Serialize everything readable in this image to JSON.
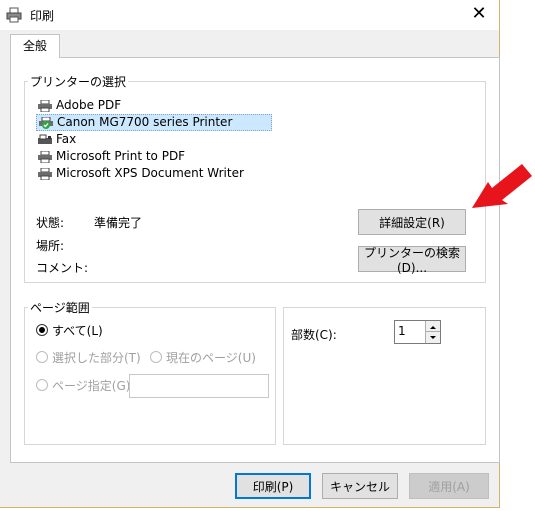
{
  "window": {
    "title": "印刷",
    "close_glyph": "✕"
  },
  "tabs": [
    {
      "label": "全般"
    }
  ],
  "printer_group": {
    "label": "プリンターの選択",
    "printers": [
      {
        "name": "Adobe PDF",
        "icon": "printer-icon",
        "selected": false
      },
      {
        "name": "Canon MG7700 series Printer",
        "icon": "printer-default-icon",
        "selected": true
      },
      {
        "name": "Fax",
        "icon": "fax-icon",
        "selected": false
      },
      {
        "name": "Microsoft Print to PDF",
        "icon": "printer-icon",
        "selected": false
      },
      {
        "name": "Microsoft XPS Document Writer",
        "icon": "printer-icon",
        "selected": false
      }
    ],
    "status_label": "状態:",
    "status_value": "準備完了",
    "location_label": "場所:",
    "comment_label": "コメント:",
    "advanced_button": "詳細設定(R)",
    "find_printer_button": "プリンターの検索(D)..."
  },
  "page_range": {
    "label": "ページ範囲",
    "all": "すべて(L)",
    "selection": "選択した部分(T)",
    "current_page": "現在のページ(U)",
    "pages": "ページ指定(G):",
    "pages_value": ""
  },
  "copies": {
    "label": "部数(C):",
    "value": "1"
  },
  "footer": {
    "print_button": "印刷(P)",
    "cancel_button": "キャンセル",
    "apply_button": "適用(A)"
  },
  "annotation": {
    "arrow_color": "#e8141c"
  },
  "colors": {
    "accent": "#0078d7",
    "selection": "#cce8ff"
  }
}
